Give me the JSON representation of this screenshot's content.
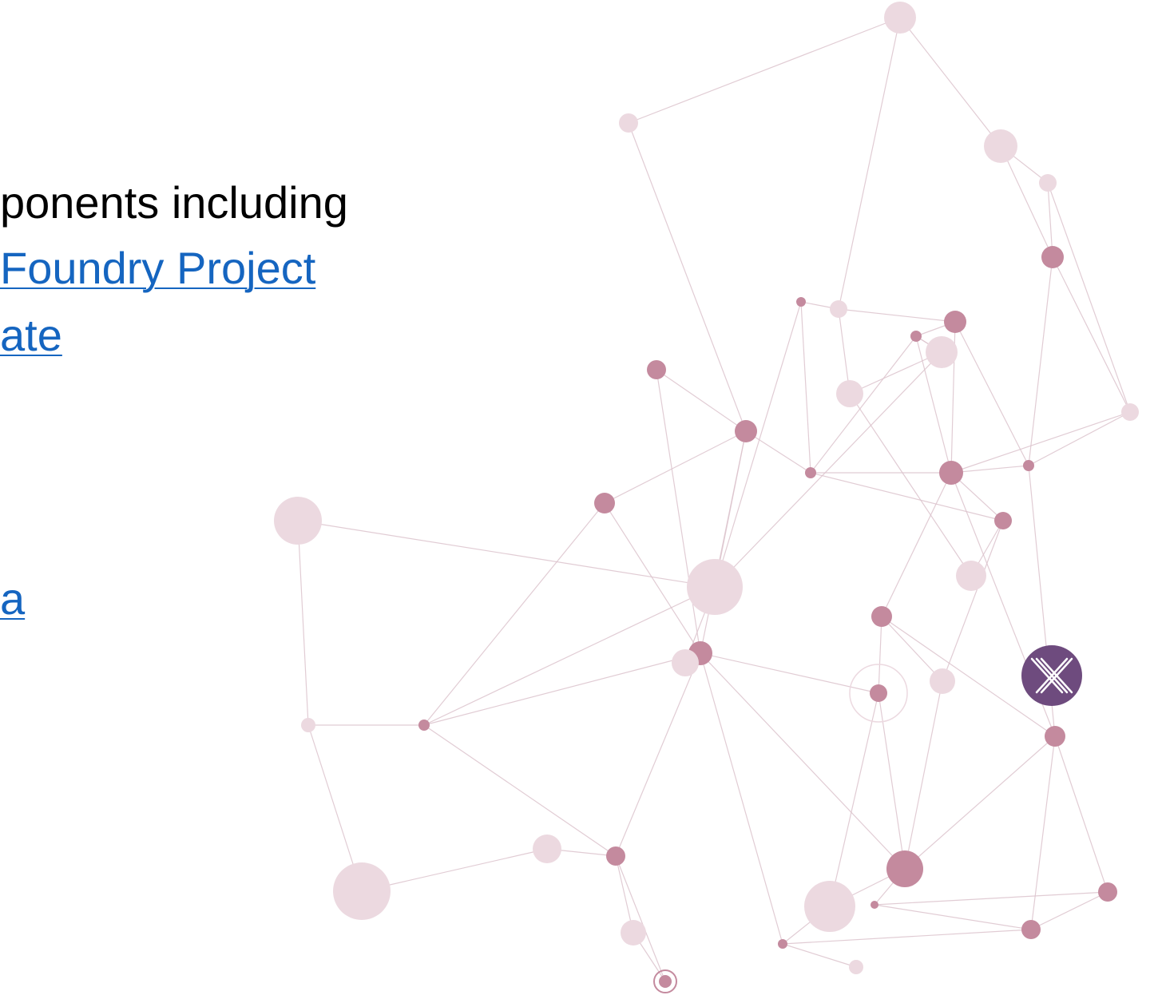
{
  "slide": {
    "text_lines": [
      "ponents including",
      "Foundry Project",
      "ate",
      "a"
    ]
  },
  "colors": {
    "text": "#000000",
    "link": "#1565c0",
    "node_dark": "#c48a9e",
    "node_light": "#ecd9e0",
    "edge": "#dcc3cc",
    "logo_bg": "#6e4b7e"
  },
  "icons": {
    "logo": "x-logo-icon"
  }
}
